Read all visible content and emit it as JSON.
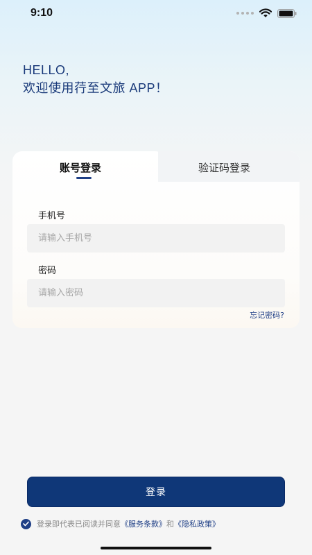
{
  "status_bar": {
    "time": "9:10"
  },
  "greeting": {
    "line1": "HELLO,",
    "line2": "欢迎使用荇至文旅 APP！"
  },
  "tabs": [
    {
      "label": "账号登录",
      "active": true
    },
    {
      "label": "验证码登录",
      "active": false
    }
  ],
  "form": {
    "phone": {
      "label": "手机号",
      "placeholder": "请输入手机号",
      "value": ""
    },
    "password": {
      "label": "密码",
      "placeholder": "请输入密码",
      "value": ""
    },
    "forgot_password": "忘记密码?"
  },
  "login_button_label": "登录",
  "agreement": {
    "checked": true,
    "prefix": "登录即代表已阅读并同意",
    "terms": "《服务条款》",
    "and": "和",
    "privacy": "《隐私政策》"
  },
  "colors": {
    "accent": "#0f3778",
    "link": "#1f3f86"
  },
  "icons": [
    "signal-dots-icon",
    "wifi-icon",
    "battery-icon",
    "checkmark-icon"
  ]
}
